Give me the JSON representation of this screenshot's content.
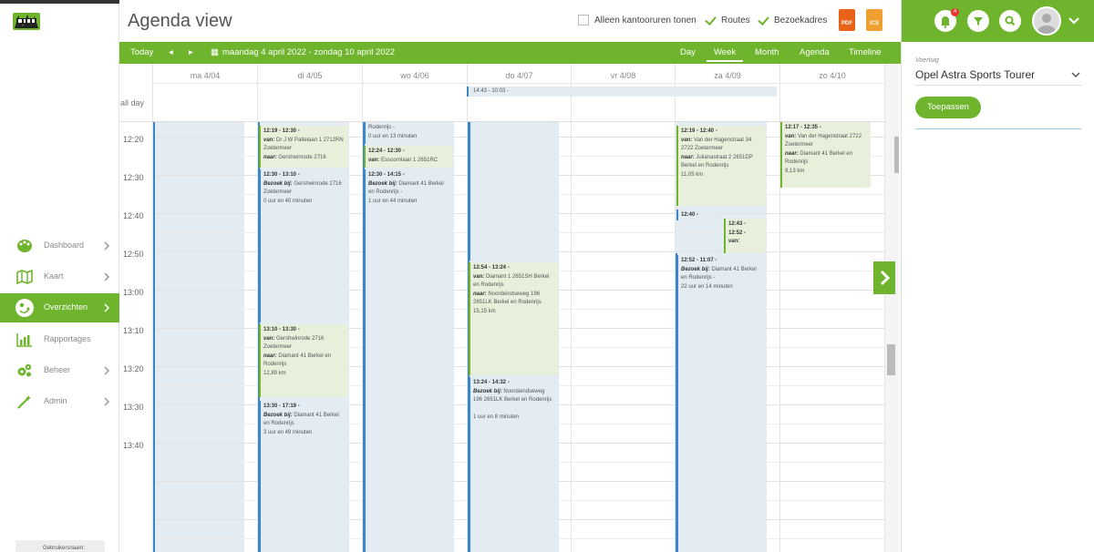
{
  "sidebar": {
    "items": [
      {
        "label": "Dashboard",
        "icon": "palette-icon"
      },
      {
        "label": "Kaart",
        "icon": "map-icon"
      },
      {
        "label": "Overzichten",
        "icon": "route-icon",
        "active": true
      },
      {
        "label": "Rapportages",
        "icon": "bar-chart-icon"
      },
      {
        "label": "Beheer",
        "icon": "gears-icon"
      },
      {
        "label": "Admin",
        "icon": "wand-icon"
      }
    ],
    "user_label": "Gebruikersnaam:"
  },
  "header": {
    "title": "Agenda view",
    "opt_office": "Alleen kantooruren tonen",
    "opt_routes": "Routes",
    "opt_visits": "Bezoekadres",
    "pdf_label": "PDF",
    "ics_label": "ICS"
  },
  "toolbar": {
    "today": "Today",
    "range": "maandag 4 april 2022 - zondag 10 april 2022",
    "views": [
      "Day",
      "Week",
      "Month",
      "Agenda",
      "Timeline"
    ],
    "selected_view": "Week"
  },
  "calendar": {
    "days": [
      "ma 4/04",
      "di 4/05",
      "wo 4/06",
      "do 4/07",
      "vr 4/08",
      "za 4/09",
      "zo 4/10"
    ],
    "all_day_label": "all day",
    "all_day_event": "14:43 - 10:03 -",
    "times": [
      "12:20",
      "12:30",
      "12:40",
      "12:50",
      "13:00",
      "13:10",
      "13:20",
      "13:30",
      "13:40"
    ]
  },
  "events": {
    "di1": {
      "time": "12:19 - 12:30 -",
      "l1k": "van:",
      "l1": "Dr J W Paltelaan 1 2712RN Zoetermeer",
      "l2k": "naar:",
      "l2": "Gershwinrode 2716"
    },
    "di2": {
      "time": "12:30 - 13:10 -",
      "l1k": "Bezoek bij:",
      "l1": "Gershwinrode 2716 Zoetermeer",
      "dur": "0 uur en 40 minuten"
    },
    "di3": {
      "time": "13:10 - 13:30 -",
      "l1k": "van:",
      "l1": "Gershwinrode 2716 Zoetermeer",
      "l2k": "naar:",
      "l2": "Diamant 41 Berkel en Rodenrijs",
      "dist": "12,89 km"
    },
    "di4": {
      "time": "13:30 - 17:19 -",
      "l1k": "Bezoek bij:",
      "l1": "Diamant 41 Berkel en Rodenrijs",
      "dur": "3 uur en 49 minuten"
    },
    "wo1": {
      "l1": "Rodenrijs -",
      "dur": "0 uur en 13 minuten"
    },
    "wo2": {
      "time": "12:24 - 12:30 -",
      "l1k": "van:",
      "l1": "Essoornlaan 1 2651RC"
    },
    "wo3": {
      "time": "12:30 - 14:15 -",
      "l1k": "Bezoek bij:",
      "l1": "Diamant 41 Berkel en Rodenrijs -",
      "dur": "1 uur en 44 minuten"
    },
    "do1": {
      "time": "12:54 - 13:24 -",
      "l1k": "van:",
      "l1": "Diamant 1 2651SH Berkel en Rodenrijs",
      "l2k": "naar:",
      "l2": "Noordeindseweg 196 2651LK Berkel en Rodenrijs",
      "dist": "15,15 km"
    },
    "do2": {
      "time": "13:24 - 14:32 -",
      "l1k": "Bezoek bij:",
      "l1": "Noordeindseweg 196 2651LK Berkel en Rodenrijs",
      "dur": "1 uur en 8 minuten"
    },
    "za1": {
      "time": "12:19 - 12:40 -",
      "l1k": "van:",
      "l1": "Van der Hagenstraat 34 2722 Zoetermeer",
      "l2k": "naar:",
      "l2": "Julianastraat 2 2651DP Berkel en Rodenrijs",
      "dist": "11,05 km"
    },
    "za2": {
      "time": "12:40 -"
    },
    "za3": {
      "time": "12:43 -",
      "time2": "12:52 -",
      "l1k": "van:"
    },
    "za4": {
      "time": "12:52 - 11:07 -",
      "l1k": "Bezoek bij:",
      "l1": "Diamant 41 Berkel en Rodenrijs -",
      "dur": "22 uur en 14 minuten"
    },
    "zo1": {
      "time": "12:17 - 12:35 -",
      "l1k": "van:",
      "l1": "Van der Hagenstraat 2722 Zoetermeer",
      "l2k": "naar:",
      "l2": "Diamant 41 Berkel en Rodenrijs",
      "dist": "9,13 km"
    }
  },
  "rpanel": {
    "badge": "4",
    "vehicle_label": "Voertuig",
    "vehicle_value": "Opel Astra Sports Tourer",
    "apply": "Toepassen"
  },
  "colors": {
    "accent": "#6eb42c",
    "event_blue": "#3a86c8",
    "col_bg": "#e4ecf3"
  }
}
